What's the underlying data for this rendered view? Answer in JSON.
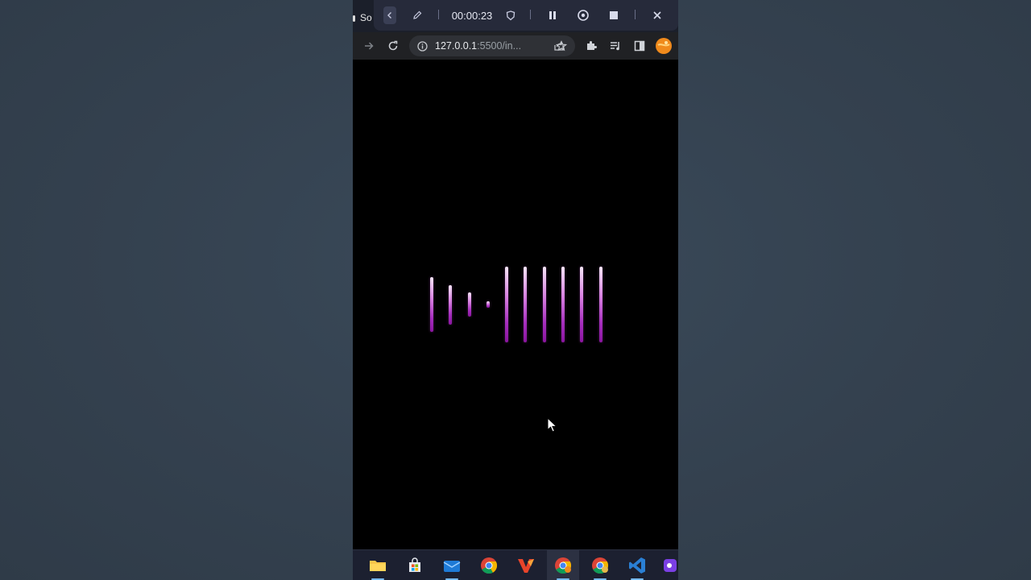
{
  "tab": {
    "fragment": "So"
  },
  "recorder": {
    "timer": "00:00:23",
    "controls": [
      "back",
      "pen",
      "shield",
      "pause",
      "restart",
      "stop",
      "close"
    ]
  },
  "browser": {
    "url_host": "127.0.0.1",
    "url_rest": ":5500/in...",
    "icons": [
      "forward-icon",
      "reload-icon",
      "info-icon",
      "share-icon",
      "star-icon",
      "extensions-icon",
      "media-icon",
      "side-panel-icon",
      "profile-avatar"
    ]
  },
  "visualizer": {
    "accent_top": "#f4e6f6",
    "accent_bottom": "#8a159f",
    "bar_levels_percent": [
      72,
      52,
      32,
      8,
      100,
      100,
      100,
      100,
      100,
      100
    ]
  },
  "taskbar": {
    "apps": [
      "file-explorer",
      "microsoft-store",
      "mail",
      "chrome",
      "vectr",
      "chrome-active",
      "chrome-profile",
      "vscode",
      "app"
    ]
  }
}
